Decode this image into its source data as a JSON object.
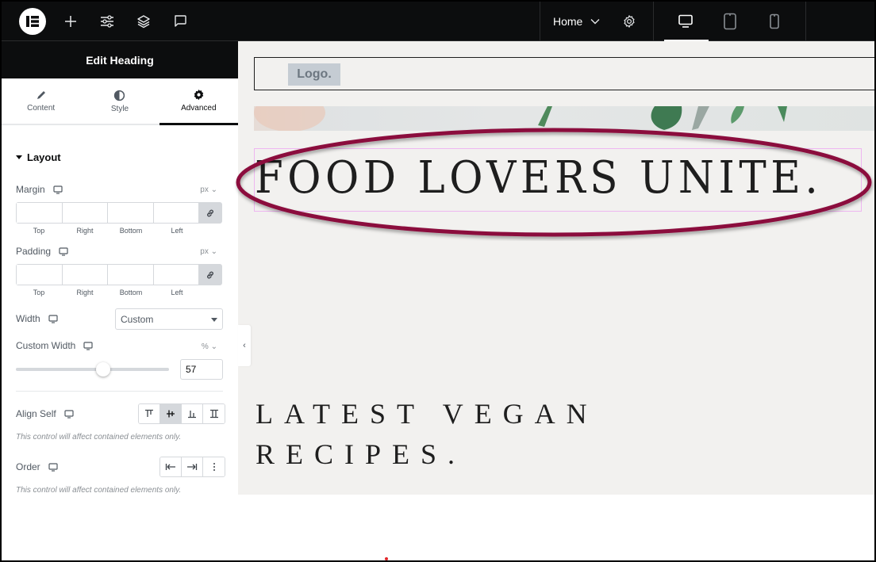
{
  "topbar": {
    "logo": "elementor-logo",
    "icons": [
      "add-element",
      "site-settings",
      "structure-layers",
      "comments"
    ],
    "page_name": "Home",
    "devices": [
      {
        "name": "desktop",
        "active": true
      },
      {
        "name": "tablet",
        "active": false
      },
      {
        "name": "mobile",
        "active": false
      }
    ]
  },
  "panel": {
    "title": "Edit Heading",
    "tabs": [
      {
        "label": "Content",
        "icon": "pencil-icon",
        "active": false
      },
      {
        "label": "Style",
        "icon": "contrast-icon",
        "active": false
      },
      {
        "label": "Advanced",
        "icon": "gear-icon",
        "active": true
      }
    ],
    "section": "Layout",
    "margin": {
      "label": "Margin",
      "unit": "px",
      "values": {
        "top": "",
        "right": "",
        "bottom": "",
        "left": ""
      },
      "sides": [
        "Top",
        "Right",
        "Bottom",
        "Left"
      ]
    },
    "padding": {
      "label": "Padding",
      "unit": "px",
      "values": {
        "top": "",
        "right": "",
        "bottom": "",
        "left": ""
      },
      "sides": [
        "Top",
        "Right",
        "Bottom",
        "Left"
      ]
    },
    "width": {
      "label": "Width",
      "value": "Custom"
    },
    "custom_width": {
      "label": "Custom Width",
      "unit": "%",
      "value": "57",
      "slider_fraction": 0.57
    },
    "align_self": {
      "label": "Align Self",
      "options": [
        "start",
        "center",
        "end",
        "stretch"
      ],
      "selected": "center",
      "note": "This control will affect contained elements only."
    },
    "order": {
      "label": "Order",
      "options": [
        "first",
        "last",
        "custom"
      ],
      "note": "This control will affect contained elements only."
    }
  },
  "canvas": {
    "logo_text": "Logo.",
    "heading": "FOOD LOVERS UNITE.",
    "sub_heading_line1": "LATEST VEGAN",
    "sub_heading_line2": "RECIPES.",
    "highlight_color": "#8b0a3c"
  }
}
